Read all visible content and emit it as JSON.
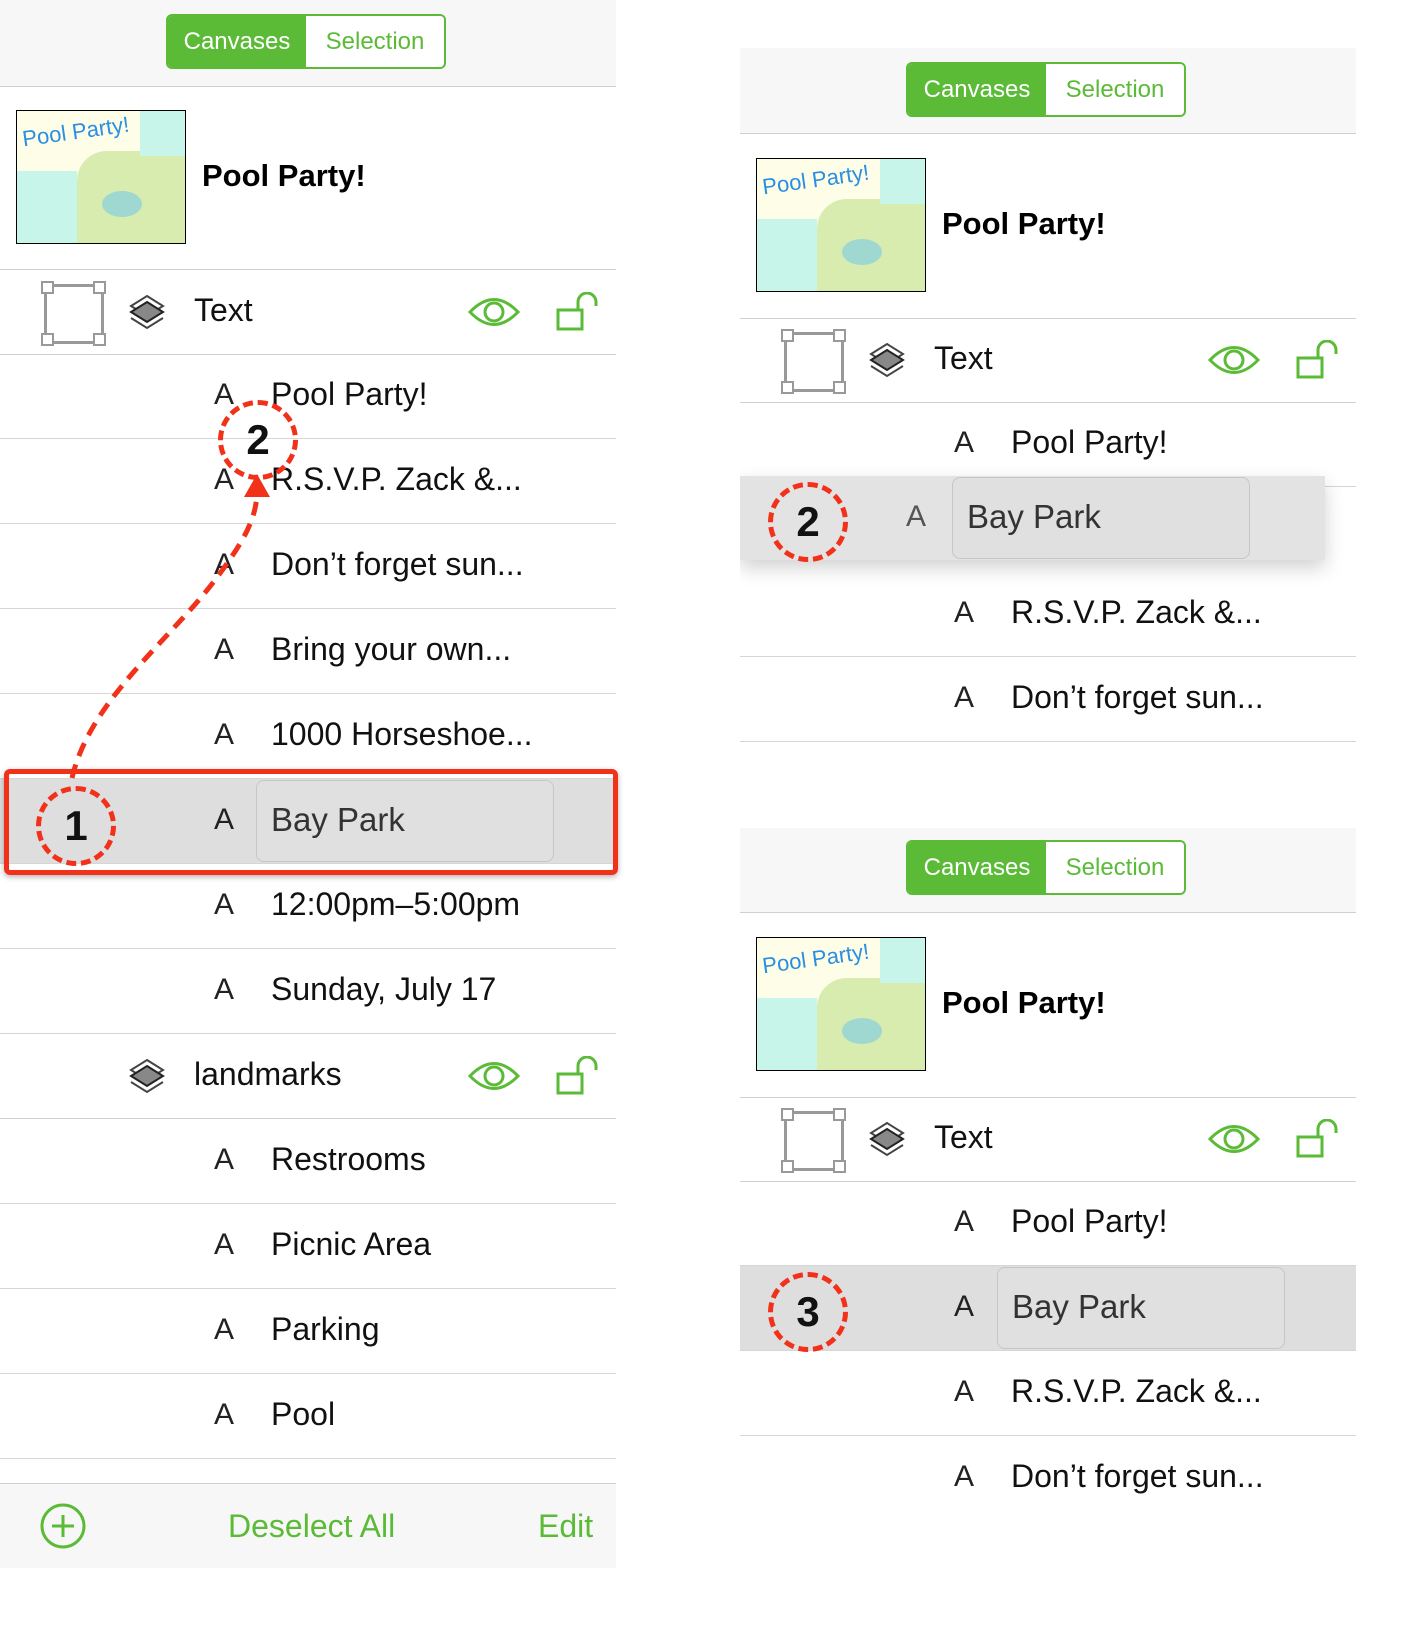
{
  "segmented": {
    "canvases": "Canvases",
    "selection": "Selection"
  },
  "canvas": {
    "title": "Pool Party!",
    "thumbnail_title": "Pool Party!"
  },
  "layer_text": "Text",
  "layer_landmarks": "landmarks",
  "left_panel": {
    "items": [
      "Pool Party!",
      "R.S.V.P. Zack &...",
      "Don’t forget sun...",
      "Bring your own...",
      "1000 Horseshoe...",
      "Bay Park",
      "12:00pm–5:00pm",
      "Sunday, July 17"
    ],
    "landmark_items": [
      "Restrooms",
      "Picnic Area",
      "Parking",
      "Pool"
    ],
    "footer": {
      "deselect_all": "Deselect All",
      "edit": "Edit"
    }
  },
  "right_top_panel": {
    "items": [
      "Pool Party!",
      "Bay Park",
      "R.S.V.P. Zack &...",
      "Don’t forget sun..."
    ]
  },
  "right_bottom_panel": {
    "items": [
      "Pool Party!",
      "Bay Park",
      "R.S.V.P. Zack &...",
      "Don’t forget sun..."
    ]
  },
  "item_icon": "A",
  "callouts": [
    "1",
    "2",
    "2",
    "3"
  ],
  "colors": {
    "accent": "#5bbb37",
    "annotation": "#f2311a",
    "selected_row": "#dedede"
  }
}
